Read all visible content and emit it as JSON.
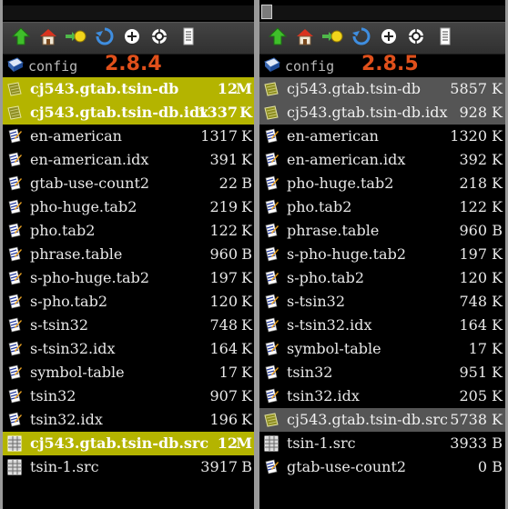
{
  "left_pane": {
    "path": "config",
    "version": "2.8.4",
    "files": [
      {
        "name": "cj543.gtab.tsin-db",
        "size": "12",
        "unit": "M",
        "icon": "package-icon",
        "selected": "yellow"
      },
      {
        "name": "cj543.gtab.tsin-db.idx",
        "size": "1337",
        "unit": "K",
        "icon": "package-icon",
        "selected": "yellow"
      },
      {
        "name": "en-american",
        "size": "1317",
        "unit": "K",
        "icon": "document-icon",
        "selected": ""
      },
      {
        "name": "en-american.idx",
        "size": "391",
        "unit": "K",
        "icon": "document-icon",
        "selected": ""
      },
      {
        "name": "gtab-use-count2",
        "size": "22",
        "unit": "B",
        "icon": "document-icon",
        "selected": ""
      },
      {
        "name": "pho-huge.tab2",
        "size": "219",
        "unit": "K",
        "icon": "document-icon",
        "selected": ""
      },
      {
        "name": "pho.tab2",
        "size": "122",
        "unit": "K",
        "icon": "document-icon",
        "selected": ""
      },
      {
        "name": "phrase.table",
        "size": "960",
        "unit": "B",
        "icon": "document-icon",
        "selected": ""
      },
      {
        "name": "s-pho-huge.tab2",
        "size": "197",
        "unit": "K",
        "icon": "document-icon",
        "selected": ""
      },
      {
        "name": "s-pho.tab2",
        "size": "120",
        "unit": "K",
        "icon": "document-icon",
        "selected": ""
      },
      {
        "name": "s-tsin32",
        "size": "748",
        "unit": "K",
        "icon": "document-icon",
        "selected": ""
      },
      {
        "name": "s-tsin32.idx",
        "size": "164",
        "unit": "K",
        "icon": "document-icon",
        "selected": ""
      },
      {
        "name": "symbol-table",
        "size": "17",
        "unit": "K",
        "icon": "document-icon",
        "selected": ""
      },
      {
        "name": "tsin32",
        "size": "907",
        "unit": "K",
        "icon": "document-icon",
        "selected": ""
      },
      {
        "name": "tsin32.idx",
        "size": "196",
        "unit": "K",
        "icon": "document-icon",
        "selected": ""
      },
      {
        "name": "cj543.gtab.tsin-db.src",
        "size": "12",
        "unit": "M",
        "icon": "spreadsheet-icon",
        "selected": "yellow"
      },
      {
        "name": "tsin-1.src",
        "size": "3917",
        "unit": "B",
        "icon": "spreadsheet-icon",
        "selected": ""
      }
    ]
  },
  "right_pane": {
    "path": "config",
    "version": "2.8.5",
    "files": [
      {
        "name": "cj543.gtab.tsin-db",
        "size": "5857",
        "unit": "K",
        "icon": "package-icon",
        "selected": "gray"
      },
      {
        "name": "cj543.gtab.tsin-db.idx",
        "size": "928",
        "unit": "K",
        "icon": "package-icon",
        "selected": "gray"
      },
      {
        "name": "en-american",
        "size": "1320",
        "unit": "K",
        "icon": "document-icon",
        "selected": ""
      },
      {
        "name": "en-american.idx",
        "size": "392",
        "unit": "K",
        "icon": "document-icon",
        "selected": ""
      },
      {
        "name": "pho-huge.tab2",
        "size": "218",
        "unit": "K",
        "icon": "document-icon",
        "selected": ""
      },
      {
        "name": "pho.tab2",
        "size": "122",
        "unit": "K",
        "icon": "document-icon",
        "selected": ""
      },
      {
        "name": "phrase.table",
        "size": "960",
        "unit": "B",
        "icon": "document-icon",
        "selected": ""
      },
      {
        "name": "s-pho-huge.tab2",
        "size": "197",
        "unit": "K",
        "icon": "document-icon",
        "selected": ""
      },
      {
        "name": "s-pho.tab2",
        "size": "120",
        "unit": "K",
        "icon": "document-icon",
        "selected": ""
      },
      {
        "name": "s-tsin32",
        "size": "748",
        "unit": "K",
        "icon": "document-icon",
        "selected": ""
      },
      {
        "name": "s-tsin32.idx",
        "size": "164",
        "unit": "K",
        "icon": "document-icon",
        "selected": ""
      },
      {
        "name": "symbol-table",
        "size": "17",
        "unit": "K",
        "icon": "document-icon",
        "selected": ""
      },
      {
        "name": "tsin32",
        "size": "951",
        "unit": "K",
        "icon": "document-icon",
        "selected": ""
      },
      {
        "name": "tsin32.idx",
        "size": "205",
        "unit": "K",
        "icon": "document-icon",
        "selected": ""
      },
      {
        "name": "cj543.gtab.tsin-db.src",
        "size": "5738",
        "unit": "K",
        "icon": "package-icon",
        "selected": "gray"
      },
      {
        "name": "tsin-1.src",
        "size": "3933",
        "unit": "B",
        "icon": "spreadsheet-icon",
        "selected": ""
      },
      {
        "name": "gtab-use-count2",
        "size": "0",
        "unit": "B",
        "icon": "document-icon",
        "selected": ""
      }
    ]
  },
  "toolbar_icons": [
    "up-arrow-icon",
    "home-icon",
    "bookmark-key-icon",
    "refresh-icon",
    "add-circle-icon",
    "target-circle-icon",
    "notepad-icon"
  ],
  "colors": {
    "version": "#e0501b",
    "highlight_yellow": "#b4b400",
    "highlight_gray": "#555555"
  }
}
